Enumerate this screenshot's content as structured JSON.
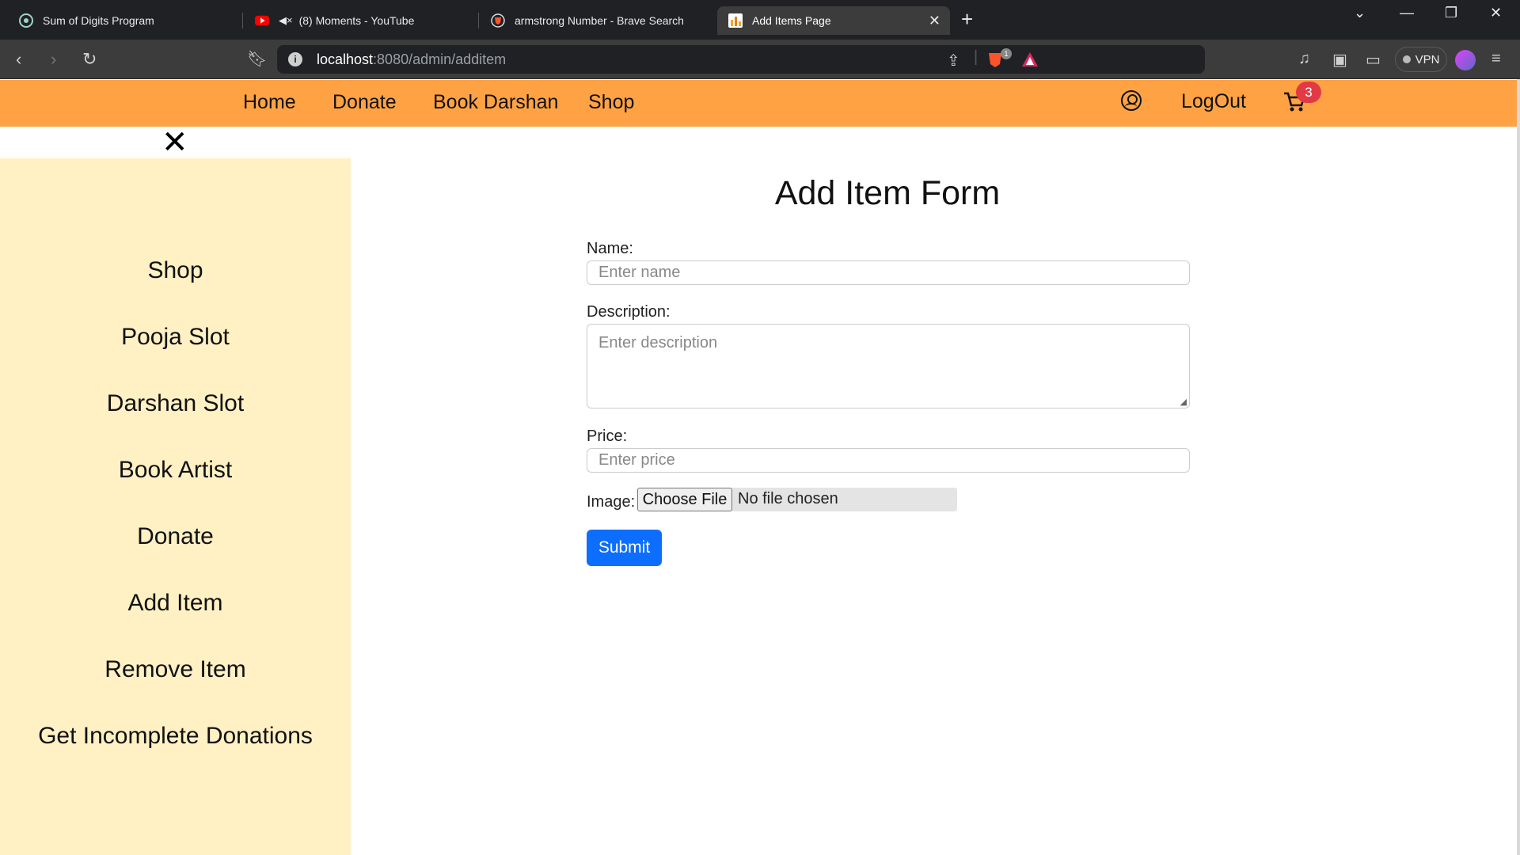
{
  "browser": {
    "tabs": [
      {
        "title": "Sum of Digits Program",
        "icon": "chatgpt-icon"
      },
      {
        "title": "(8) Moments - YouTube",
        "icon": "youtube-icon"
      },
      {
        "title": "armstrong Number - Brave Search",
        "icon": "brave-search-icon"
      },
      {
        "title": "Add Items Page",
        "icon": "site-favicon",
        "active": true
      }
    ],
    "url_host": "localhost",
    "url_path": ":8080/admin/additem",
    "vpn_label": "VPN",
    "brave_badge": "1"
  },
  "navbar": {
    "links": [
      "Home",
      "Donate",
      "Book Darshan",
      "Shop"
    ],
    "logout_label": "LogOut",
    "cart_count": "3",
    "bg_color": "#ffa244"
  },
  "sidebar": {
    "items": [
      "Shop",
      "Pooja Slot",
      "Darshan Slot",
      "Book Artist",
      "Donate",
      "Add Item",
      "Remove Item",
      "Get Incomplete Donations"
    ],
    "bg_color": "#fff1c4"
  },
  "form": {
    "title": "Add Item Form",
    "name_label": "Name:",
    "name_placeholder": "Enter name",
    "description_label": "Description:",
    "description_placeholder": "Enter description",
    "price_label": "Price:",
    "price_placeholder": "Enter price",
    "image_label": "Image:",
    "file_button": "Choose File",
    "file_status": "No file chosen",
    "submit_label": "Submit",
    "submit_color": "#0d6efd"
  }
}
